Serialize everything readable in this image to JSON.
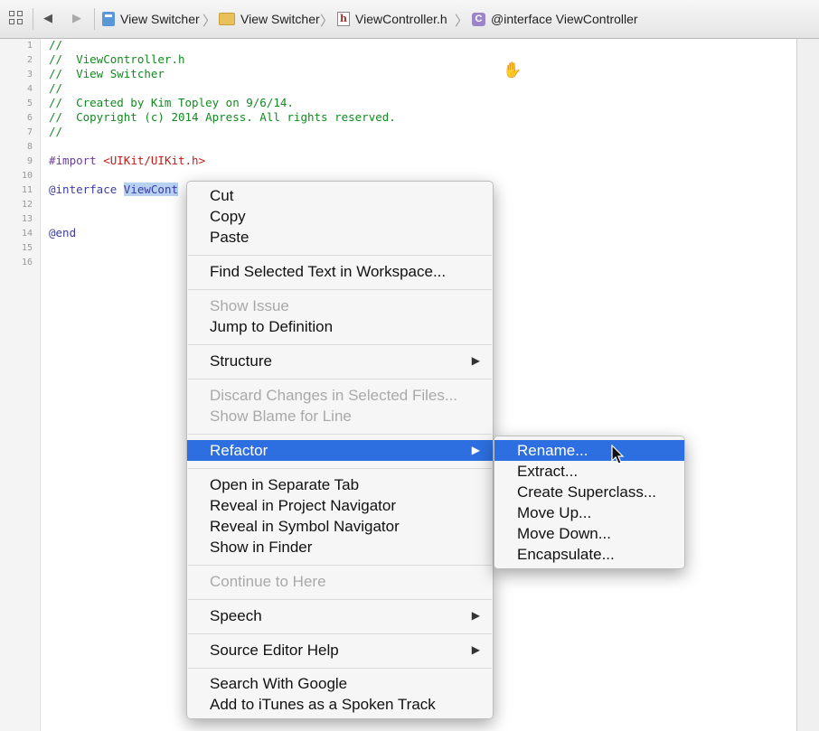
{
  "jumpbar": {
    "crumbs": [
      {
        "label": "View Switcher",
        "icon": "project-icon"
      },
      {
        "label": "View Switcher",
        "icon": "folder-icon"
      },
      {
        "label": "ViewController.h",
        "icon": "header-file-icon"
      },
      {
        "label": "@interface ViewController",
        "icon": "class-icon"
      }
    ],
    "back_glyph": "◀",
    "forward_glyph": "▶",
    "separator_glyph": "〉"
  },
  "editor": {
    "line_numbers": [
      "1",
      "2",
      "3",
      "4",
      "5",
      "6",
      "7",
      "8",
      "9",
      "10",
      "11",
      "12",
      "13",
      "14",
      "15",
      "16"
    ],
    "lines": {
      "l1": "//",
      "l2": "//  ViewController.h",
      "l3": "//  View Switcher",
      "l4": "//",
      "l5": "//  Created by Kim Topley on 9/6/14.",
      "l6": "//  Copyright (c) 2014 Apress. All rights reserved.",
      "l7": "//",
      "l9_directive": "#import ",
      "l9_path": "<UIKit/UIKit.h>",
      "l11_keyword": "@interface ",
      "l11_selected": "ViewCont",
      "l14": "@end"
    }
  },
  "context_menu": {
    "cut": "Cut",
    "copy": "Copy",
    "paste": "Paste",
    "find_selected": "Find Selected Text in Workspace...",
    "show_issue": "Show Issue",
    "jump_to_definition": "Jump to Definition",
    "structure": "Structure",
    "discard_changes": "Discard Changes in Selected Files...",
    "show_blame": "Show Blame for Line",
    "refactor": "Refactor",
    "open_separate_tab": "Open in Separate Tab",
    "reveal_project_nav": "Reveal in Project Navigator",
    "reveal_symbol_nav": "Reveal in Symbol Navigator",
    "show_in_finder": "Show in Finder",
    "continue_to_here": "Continue to Here",
    "speech": "Speech",
    "source_editor_help": "Source Editor Help",
    "search_google": "Search With Google",
    "add_itunes": "Add to iTunes as a Spoken Track",
    "submenu_arrow": "▶"
  },
  "refactor_submenu": {
    "rename": "Rename...",
    "extract": "Extract...",
    "create_superclass": "Create Superclass...",
    "move_up": "Move Up...",
    "move_down": "Move Down...",
    "encapsulate": "Encapsulate..."
  },
  "colors": {
    "highlight": "#2d6fe0",
    "comment": "#118a1f",
    "keyword": "#3d3ca3",
    "string": "#c41a16"
  }
}
